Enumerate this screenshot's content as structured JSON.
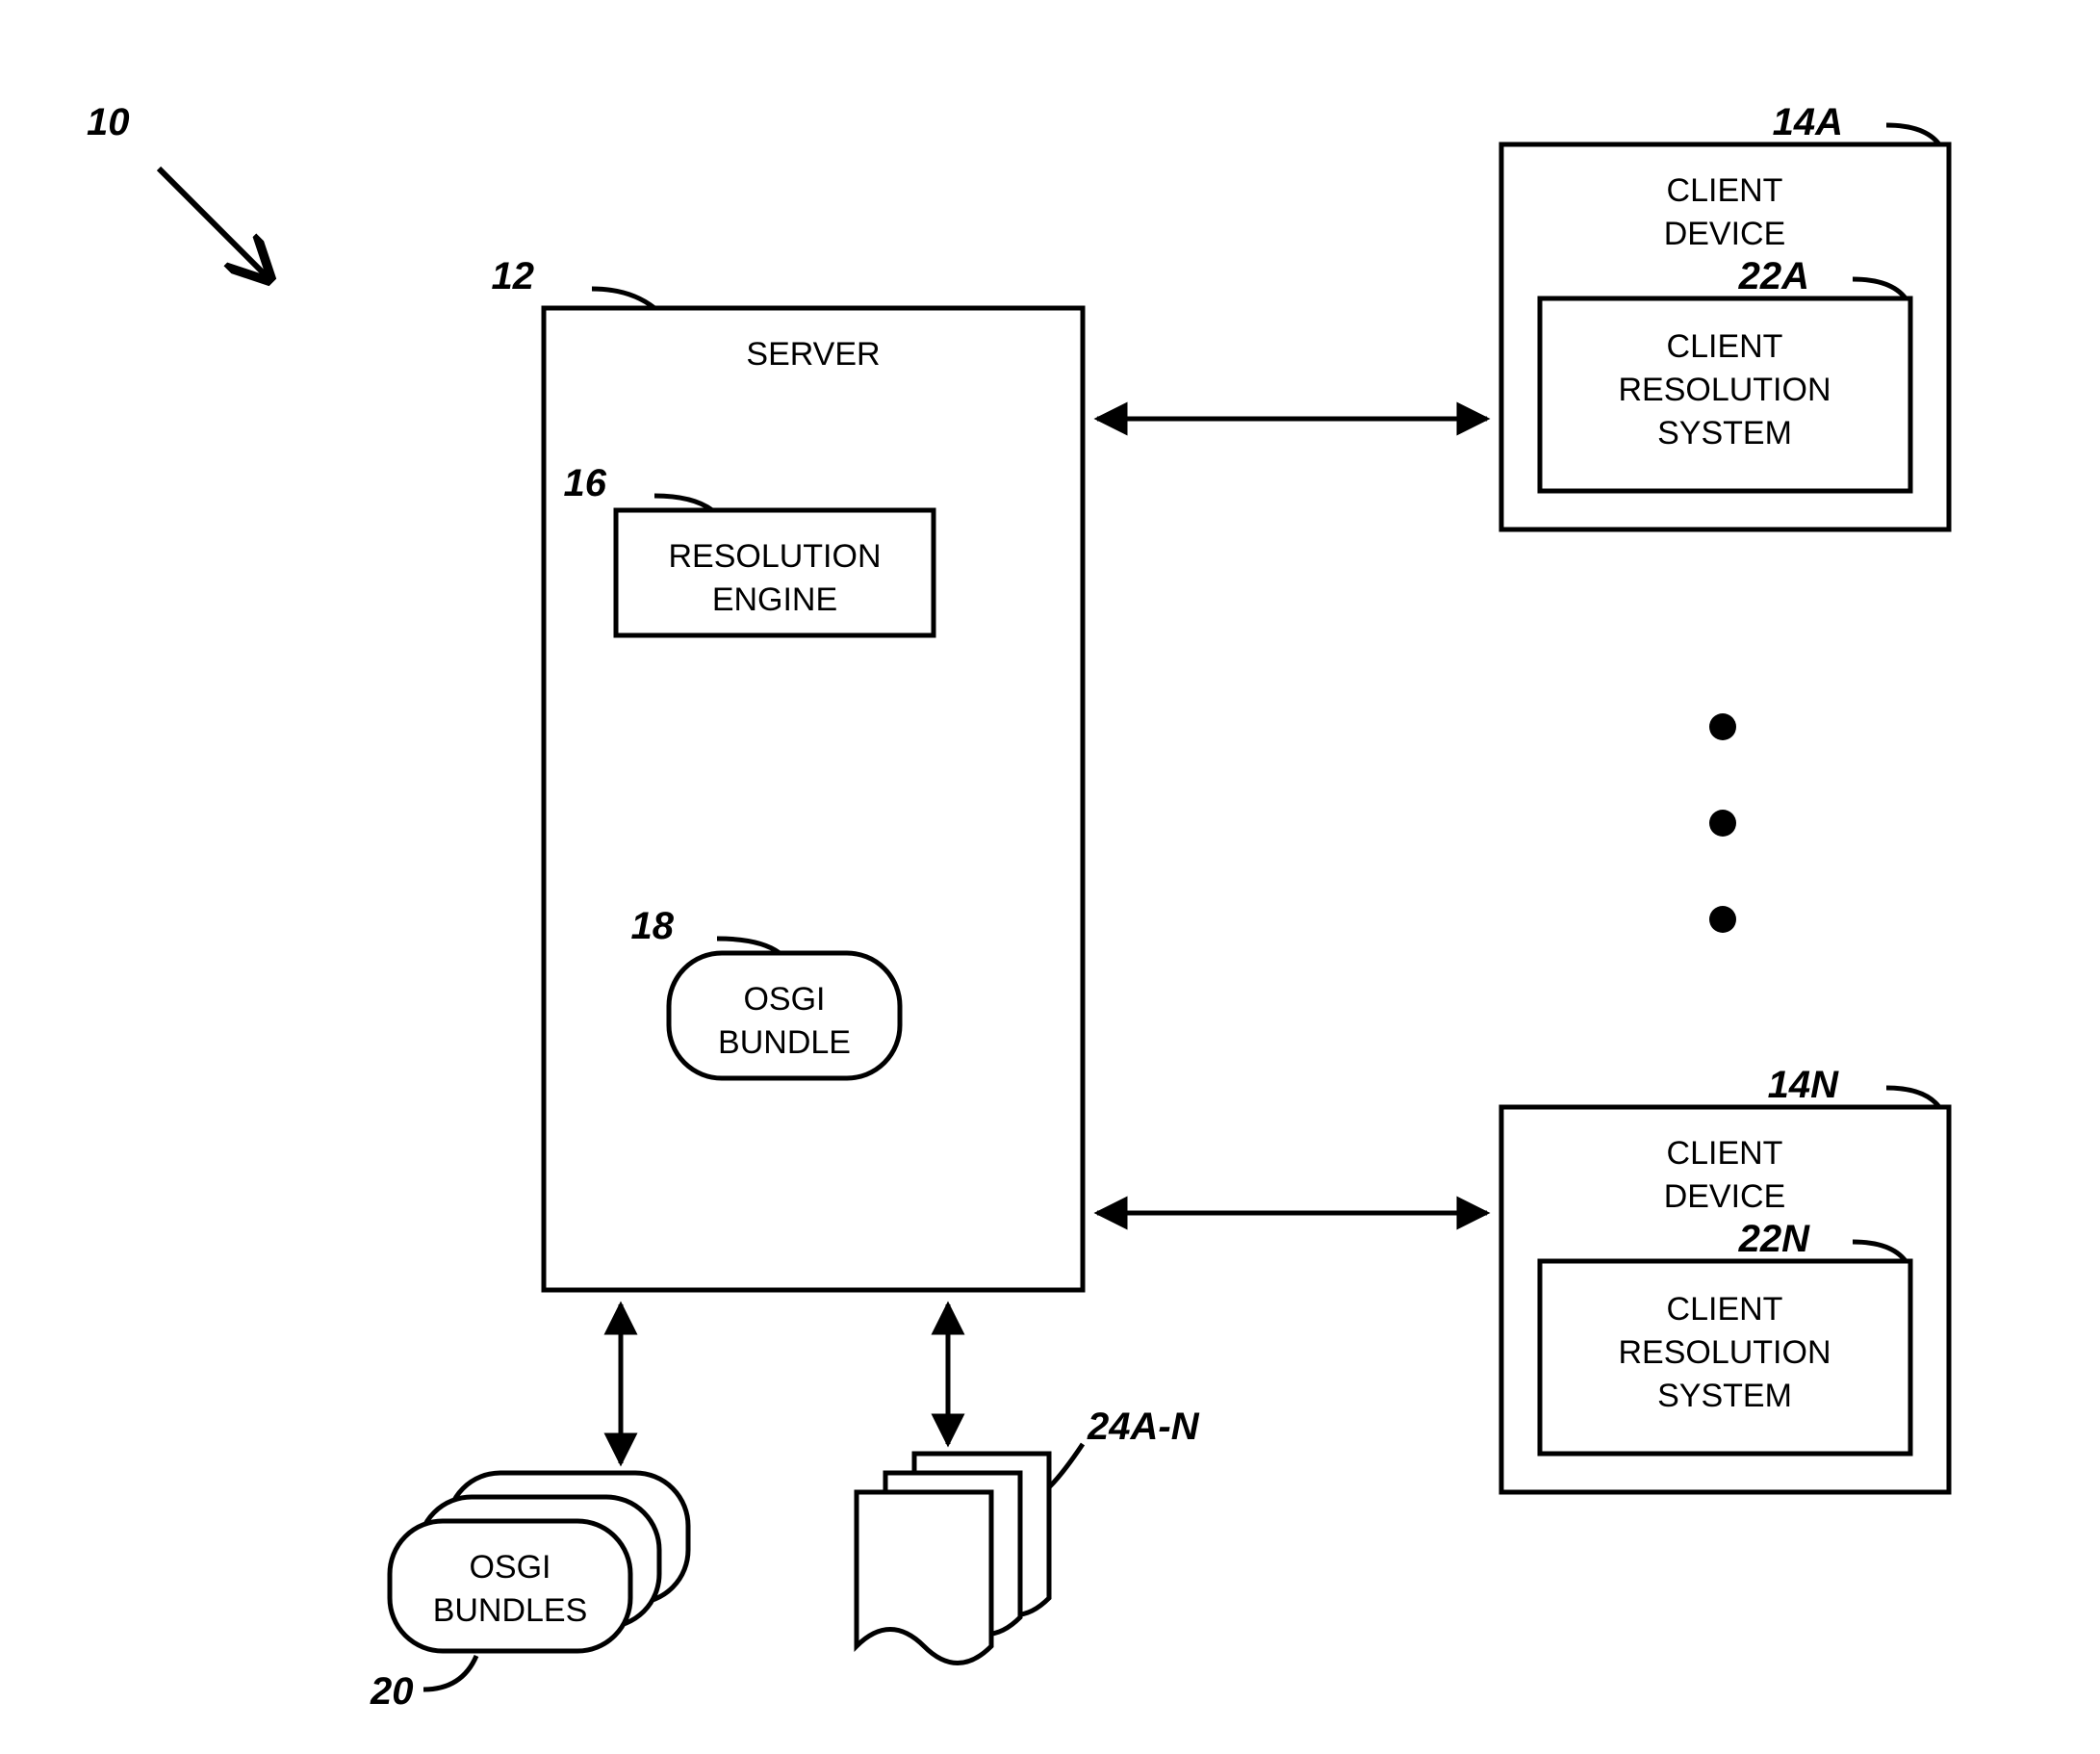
{
  "refs": {
    "whole": "10",
    "server": "12",
    "clientA": "14A",
    "clientN": "14N",
    "resEngine": "16",
    "osgiBundle": "18",
    "osgiBundles": "20",
    "crsA": "22A",
    "crsN": "22N",
    "docs": "24A-N"
  },
  "labels": {
    "server": "SERVER",
    "resEngine1": "RESOLUTION",
    "resEngine2": "ENGINE",
    "osgiBundle1": "OSGI",
    "osgiBundle2": "BUNDLE",
    "osgiBundles1": "OSGI",
    "osgiBundles2": "BUNDLES",
    "clientDev1": "CLIENT",
    "clientDev2": "DEVICE",
    "crs1": "CLIENT",
    "crs2": "RESOLUTION",
    "crs3": "SYSTEM"
  }
}
